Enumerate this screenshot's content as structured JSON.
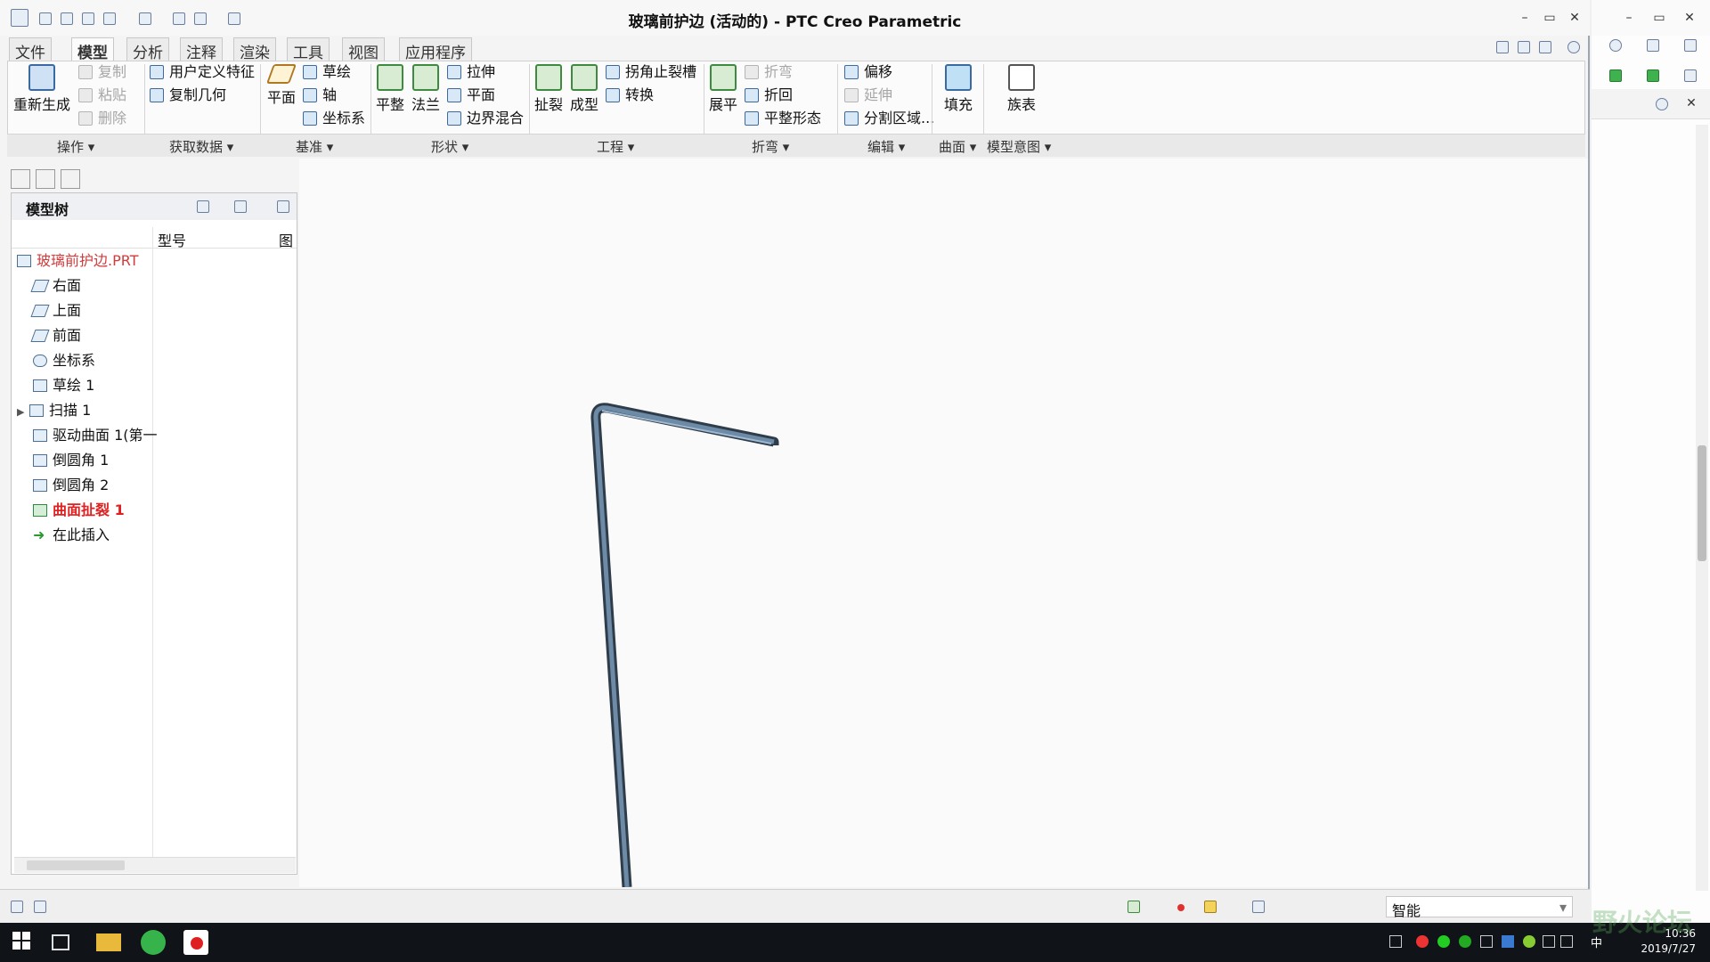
{
  "window": {
    "title": "玻璃前护边 (活动的) - PTC Creo Parametric",
    "minimize": "–",
    "restore": "▭",
    "close": "✕"
  },
  "tabs": [
    "文件",
    "模型",
    "分析",
    "注释",
    "渲染",
    "工具",
    "视图",
    "应用程序"
  ],
  "active_tab": "模型",
  "ribbon": {
    "regenerate": "重新生成",
    "copy": "复制",
    "paste": "粘贴",
    "delete": "删除",
    "user_defined_feature": "用户定义特征",
    "copy_geometry": "复制几何",
    "plane": "平面",
    "sketch": "草绘",
    "axis": "轴",
    "csys": "坐标系",
    "flat": "平整",
    "flange": "法兰",
    "extrude": "拉伸",
    "plane2": "平面",
    "boundary_blend": "边界混合",
    "rip": "扯裂",
    "form": "成型",
    "corner_relief": "拐角止裂槽",
    "convert": "转换",
    "unbend": "展平",
    "bend": "折弯",
    "bend_back": "折回",
    "flat_pattern": "平整形态",
    "offset": "偏移",
    "extend": "延伸",
    "split_area": "分割区域...",
    "fill": "填充",
    "family_table": "族表"
  },
  "groups": [
    "操作",
    "获取数据",
    "基准",
    "形状",
    "工程",
    "折弯",
    "编辑",
    "曲面",
    "模型意图"
  ],
  "model_tree": {
    "title": "模型树",
    "column_type": "型号",
    "column_icon": "图",
    "root": "玻璃前护边.PRT",
    "items": [
      "右面",
      "上面",
      "前面",
      "坐标系",
      "草绘 1",
      "扫描 1",
      "驱动曲面 1(第一",
      "倒圆角 1",
      "倒圆角 2",
      "曲面扯裂 1",
      "在此插入"
    ]
  },
  "status": {
    "selection_filter": "智能"
  },
  "taskbar": {
    "time": "10:36",
    "date": "2019/7/27",
    "ime": "中"
  },
  "watermark": "野火论坛",
  "colors": {
    "tab_active_bg": "#fbfbfb",
    "error_red": "#e02020",
    "model_steel": "#4a6782"
  }
}
